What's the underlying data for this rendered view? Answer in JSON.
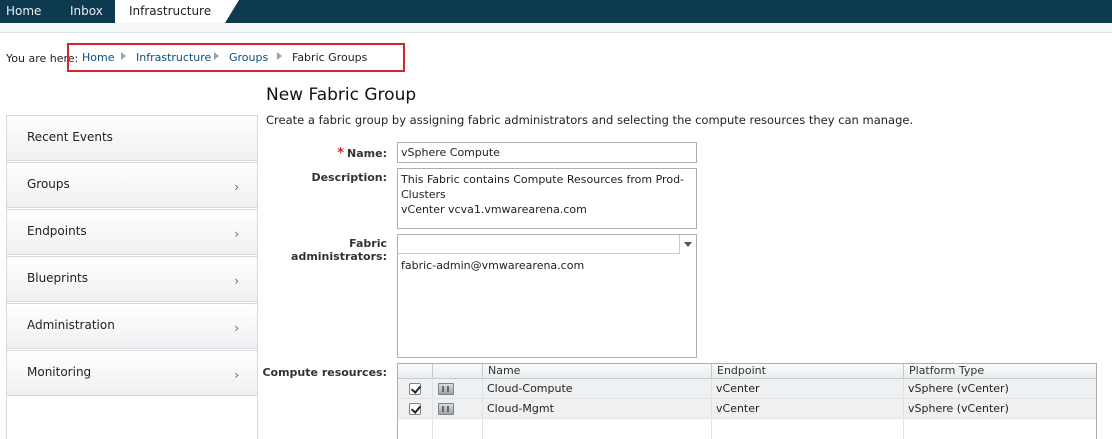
{
  "topnav": {
    "tabs": [
      {
        "label": "Home"
      },
      {
        "label": "Inbox"
      },
      {
        "label": "Infrastructure"
      }
    ]
  },
  "breadcrumb": {
    "prefix": "You are here:",
    "items": [
      "Home",
      "Infrastructure",
      "Groups",
      "Fabric Groups"
    ]
  },
  "leftnav": {
    "items": [
      {
        "label": "Recent Events"
      },
      {
        "label": "Groups"
      },
      {
        "label": "Endpoints"
      },
      {
        "label": "Blueprints"
      },
      {
        "label": "Administration"
      },
      {
        "label": "Monitoring"
      }
    ]
  },
  "form": {
    "title": "New Fabric Group",
    "description_text": "Create a fabric group by assigning fabric administrators and selecting the compute resources they can manage.",
    "name_label": "Name:",
    "name_value": "vSphere Compute",
    "description_label": "Description:",
    "description_value": "This Fabric contains Compute Resources from Prod-Clusters\nvCenter vcva1.vmwarearena.com",
    "admins_label": "Fabric administrators:",
    "admins_input_value": "",
    "admins_selected": [
      "fabric-admin@vmwarearena.com"
    ],
    "compute_label": "Compute resources:"
  },
  "grid": {
    "columns": [
      "Name",
      "Endpoint",
      "Platform Type"
    ],
    "rows": [
      {
        "name": "Cloud-Compute",
        "endpoint": "vCenter",
        "platform": "vSphere (vCenter)",
        "checked": true
      },
      {
        "name": "Cloud-Mgmt",
        "endpoint": "vCenter",
        "platform": "vSphere (vCenter)",
        "checked": true
      }
    ]
  },
  "colors": {
    "topnav_bg": "#0e3a4f",
    "link": "#0b4f7a",
    "required_star": "#d4262c",
    "highlight_box": "#d4262c"
  }
}
